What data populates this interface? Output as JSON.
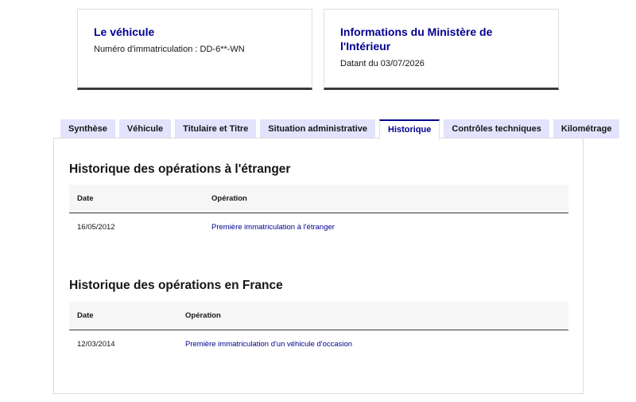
{
  "cards": {
    "vehicle": {
      "title": "Le véhicule",
      "text": "Numéro d'immatriculation : DD-6**-WN"
    },
    "ministry": {
      "title": "Informations du Ministère de l'Intérieur",
      "text": "Datant du 03/07/2026"
    }
  },
  "tabs": [
    {
      "label": "Synthèse"
    },
    {
      "label": "Véhicule"
    },
    {
      "label": "Titulaire et Titre"
    },
    {
      "label": "Situation administrative"
    },
    {
      "label": "Historique"
    },
    {
      "label": "Contrôles techniques"
    },
    {
      "label": "Kilométrage"
    }
  ],
  "foreign_history": {
    "title": "Historique des opérations à l'étranger",
    "headers": {
      "date": "Date",
      "operation": "Opération"
    },
    "rows": [
      {
        "date": "16/05/2012",
        "operation": "Première immatriculation à l'étranger"
      }
    ]
  },
  "france_history": {
    "title": "Historique des opérations en France",
    "headers": {
      "date": "Date",
      "operation": "Opération"
    },
    "rows": [
      {
        "date": "12/03/2014",
        "operation": "Première immatriculation d'un véhicule d'occasion"
      }
    ]
  },
  "colors": {
    "accent": "#000091",
    "tab_bg": "#e3e3fd",
    "header_bg": "#f6f6f6"
  }
}
